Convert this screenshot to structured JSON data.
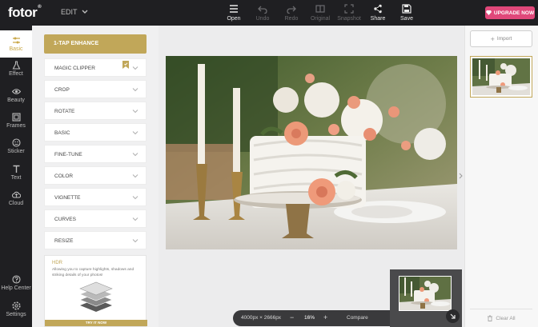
{
  "brand": {
    "logo": "fotor",
    "mode_label": "EDIT"
  },
  "toolbar": {
    "open": "Open",
    "undo": "Undo",
    "redo": "Redo",
    "original": "Original",
    "snapshot": "Snapshot",
    "share": "Share",
    "save": "Save",
    "upgrade": "UPGRADE NOW"
  },
  "sidebar": {
    "items": [
      {
        "label": "Basic",
        "icon": "sliders-icon",
        "active": true
      },
      {
        "label": "Effect",
        "icon": "flask-icon"
      },
      {
        "label": "Beauty",
        "icon": "eye-icon"
      },
      {
        "label": "Frames",
        "icon": "frame-icon"
      },
      {
        "label": "Sticker",
        "icon": "sticker-icon"
      },
      {
        "label": "Text",
        "icon": "text-icon"
      },
      {
        "label": "Cloud",
        "icon": "cloud-icon"
      }
    ],
    "help": "Help Center",
    "settings": "Settings"
  },
  "panel": {
    "enhance": "1-TAP ENHANCE",
    "rows": [
      "MAGIC CLIPPER",
      "CROP",
      "ROTATE",
      "BASIC",
      "FINE-TUNE",
      "COLOR",
      "VIGNETTE",
      "CURVES",
      "RESIZE"
    ],
    "hdr": {
      "title": "HDR",
      "description": "Allowing you to capture highlights, shadows and striking details of your photos!",
      "button": "TRY IT NOW"
    }
  },
  "canvas": {
    "dimensions": "4000px × 2666px",
    "zoom": "16%",
    "compare": "Compare",
    "zoom_out": "−",
    "zoom_in": "+"
  },
  "right_panel": {
    "import": "Import",
    "clear_all": "Clear All"
  },
  "colors": {
    "accent_gold": "#c1a759",
    "upgrade_pink": "#e0487a",
    "dark_bar": "#1f1f22"
  }
}
